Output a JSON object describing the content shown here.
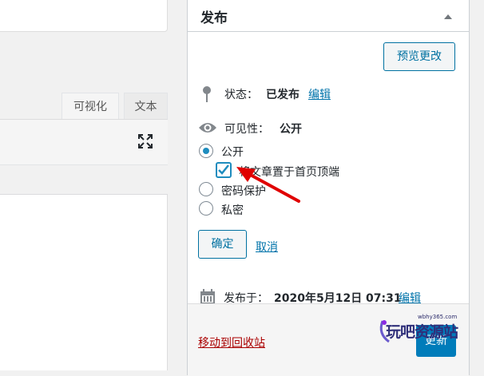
{
  "editor": {
    "tabs": [
      {
        "label": "可视化"
      },
      {
        "label": "文本"
      }
    ]
  },
  "publish_panel": {
    "title": "发布",
    "preview_button": "预览更改",
    "status": {
      "label": "状态：",
      "value": "已发布",
      "edit_link": "编辑"
    },
    "visibility": {
      "label": "可见性：",
      "value": "公开",
      "options": [
        {
          "label": "公开",
          "selected": true
        },
        {
          "label": "将文章置于首页顶端",
          "checked": true
        },
        {
          "label": "密码保护",
          "selected": false
        },
        {
          "label": "私密",
          "selected": false
        }
      ],
      "ok_button": "确定",
      "cancel_link": "取消"
    },
    "published_on": {
      "label": "发布于：",
      "value": "2020年5月12日 07:31",
      "edit_link": "编辑"
    },
    "trash_link": "移动到回收站",
    "update_button": "更新"
  },
  "watermark": {
    "domain": "wbhy365.com",
    "text": "玩吧资源站"
  },
  "colors": {
    "accent": "#0073aa",
    "button_primary": "#007cba",
    "trash_red": "#a00",
    "arrow_red": "#e00000"
  },
  "icons": [
    "pin-icon",
    "eye-icon",
    "calendar-icon",
    "fullscreen-icon",
    "collapse-arrow-icon"
  ]
}
